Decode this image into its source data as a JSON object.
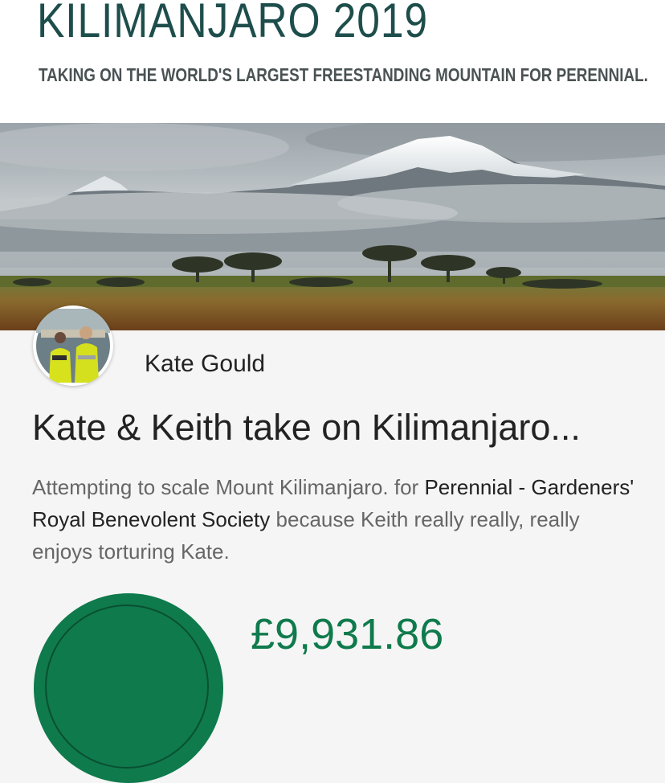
{
  "banner": {
    "title": "KILIMANJARO 2019",
    "subtitle": "TAKING ON THE WORLD'S LARGEST FREESTANDING MOUNTAIN FOR PERENNIAL."
  },
  "hero": {
    "image": "mount-kilimanjaro-savanna-photo"
  },
  "profile": {
    "avatar": "photo-of-kate-and-keith",
    "name": "Kate Gould"
  },
  "page": {
    "title": "Kate & Keith take on Kilimanjaro...",
    "description_pre": "Attempting to scale Mount Kilimanjaro. for ",
    "charity": "Perennial - Gardeners' Royal Benevolent Society",
    "description_post": " because Keith really really, really enjoys torturing Kate."
  },
  "fundraising": {
    "amount_raised": "£9,931.86"
  },
  "colors": {
    "brand_green": "#0f7a4c",
    "banner_title": "#1e4e4c",
    "text_dark": "#222222",
    "text_muted": "#666666"
  }
}
